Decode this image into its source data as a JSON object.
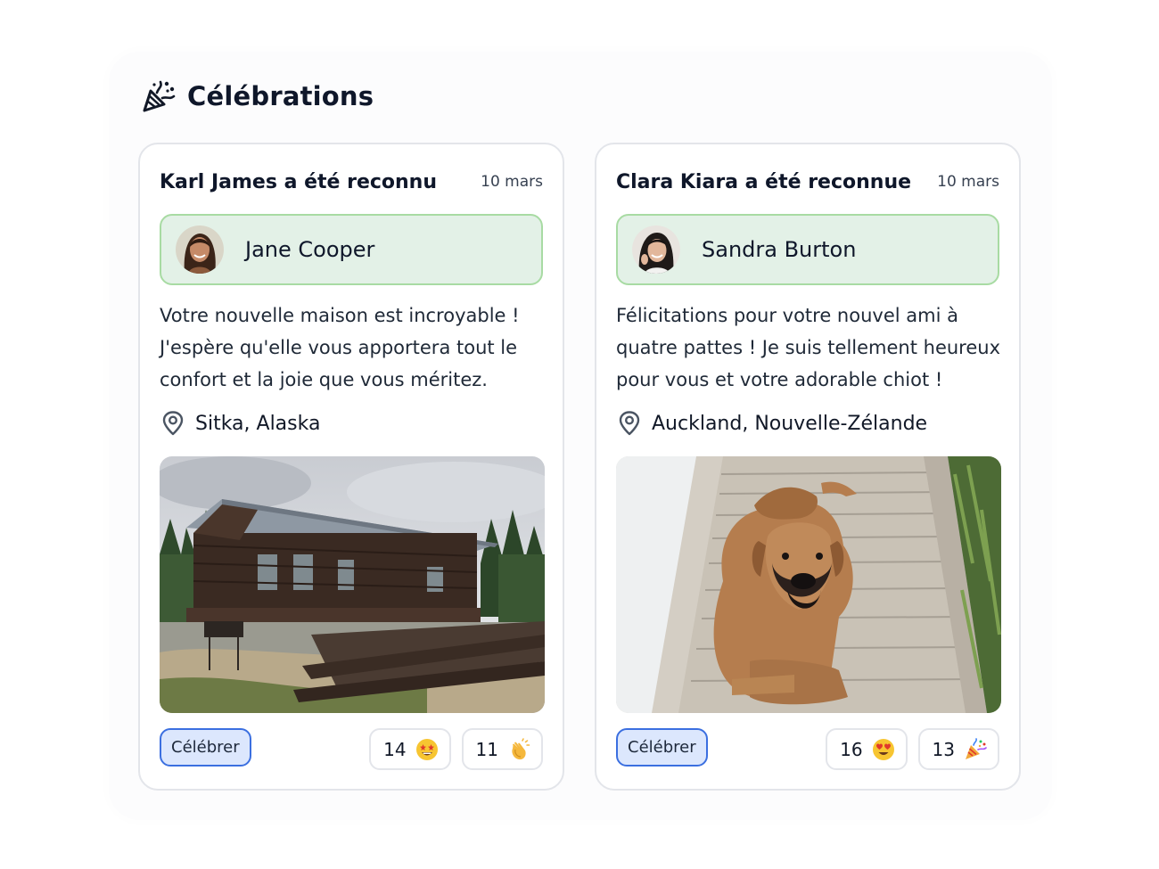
{
  "panel": {
    "title": "Célébrations",
    "icon": "party-popper-icon"
  },
  "cards": [
    {
      "title": "Karl James a été reconnu",
      "date": "10 mars",
      "person": {
        "name": "Jane Cooper",
        "avatar": "avatar-jane-cooper"
      },
      "message": "Votre nouvelle maison est incroyable ! J'espère qu'elle vous apportera tout le confort et la joie que vous méritez.",
      "location": "Sitka, Alaska",
      "photo": "log-cabin-photo",
      "celebrate_label": "Célébrer",
      "reactions": [
        {
          "count": "14",
          "emoji": "star-struck-emoji"
        },
        {
          "count": "11",
          "emoji": "clapping-hands-emoji"
        }
      ]
    },
    {
      "title": "Clara Kiara a été reconnue",
      "date": "10 mars",
      "person": {
        "name": "Sandra Burton",
        "avatar": "avatar-sandra-burton"
      },
      "message": "Félicitations pour votre nouvel ami à quatre pattes ! Je suis tellement heureux pour vous et votre adorable chiot !",
      "location": "Auckland, Nouvelle-Zélande",
      "photo": "dog-on-deck-photo",
      "celebrate_label": "Célébrer",
      "reactions": [
        {
          "count": "16",
          "emoji": "heart-eyes-emoji"
        },
        {
          "count": "13",
          "emoji": "party-popper-emoji"
        }
      ]
    }
  ],
  "colors": {
    "person_bg": "#e3f1e7",
    "person_border": "#a8dba3",
    "button_bg": "#dce7fd",
    "button_border": "#3b6fe0"
  }
}
